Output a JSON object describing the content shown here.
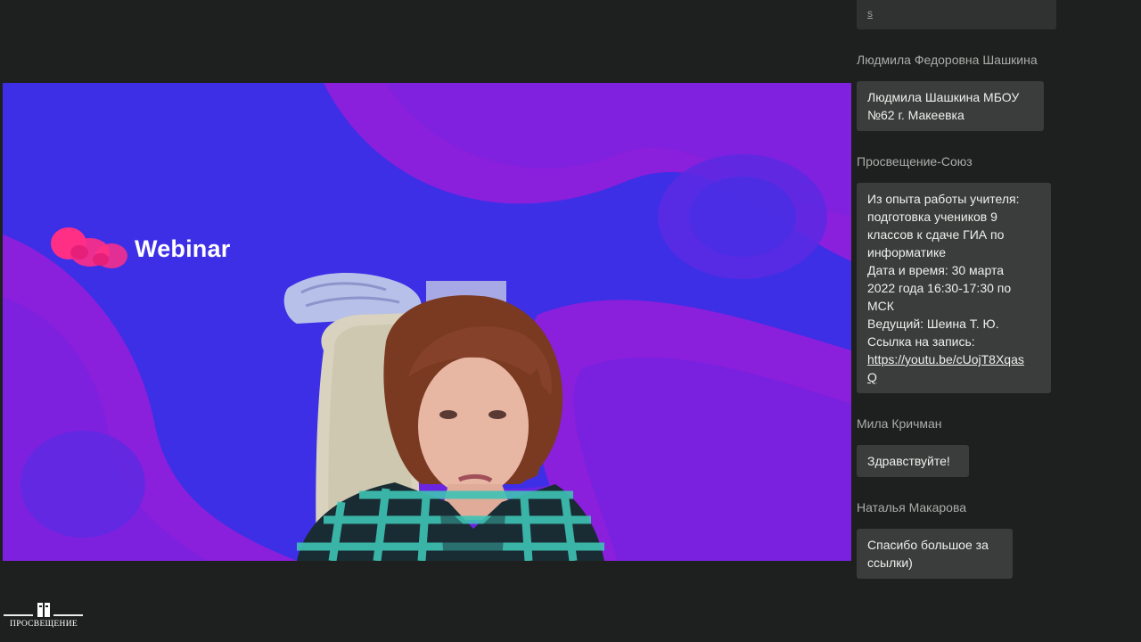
{
  "stream": {
    "brand_name": "Webinar"
  },
  "chat": {
    "previous_message_fragment": "s",
    "messages": [
      {
        "author": "Людмила Федоровна Шашкина",
        "lines": [
          "Людмила Шашкина МБОУ",
          "№62 г. Макеевка"
        ]
      },
      {
        "author": "Просвещение-Союз",
        "lines": [
          "Из опыта работы учителя:",
          "подготовка учеников 9",
          "классов к сдаче ГИА по",
          "информатике",
          "Дата и время:  30 марта",
          "2022 года 16:30-17:30 по",
          "МСК",
          "Ведущий:  Шеина Т. Ю.",
          "Ссылка на запись:"
        ],
        "link_lines": [
          "https://youtu.be/cUojT8Xqas",
          "Q"
        ]
      },
      {
        "author": "Мила Кричман",
        "lines": [
          "Здравствуйте!"
        ]
      },
      {
        "author": "Наталья Макарова",
        "lines": [
          "Спасибо большое за",
          "ссылки)"
        ]
      }
    ]
  },
  "footer": {
    "logo_text": "ПРОСВЕЩЕНИЕ"
  },
  "colors": {
    "background": "#1d201f",
    "bubble": "#3a3d3b",
    "video_blue": "#3d2fe6",
    "video_purple": "#8a1fdc",
    "brand_pink": "#ff2f86"
  }
}
